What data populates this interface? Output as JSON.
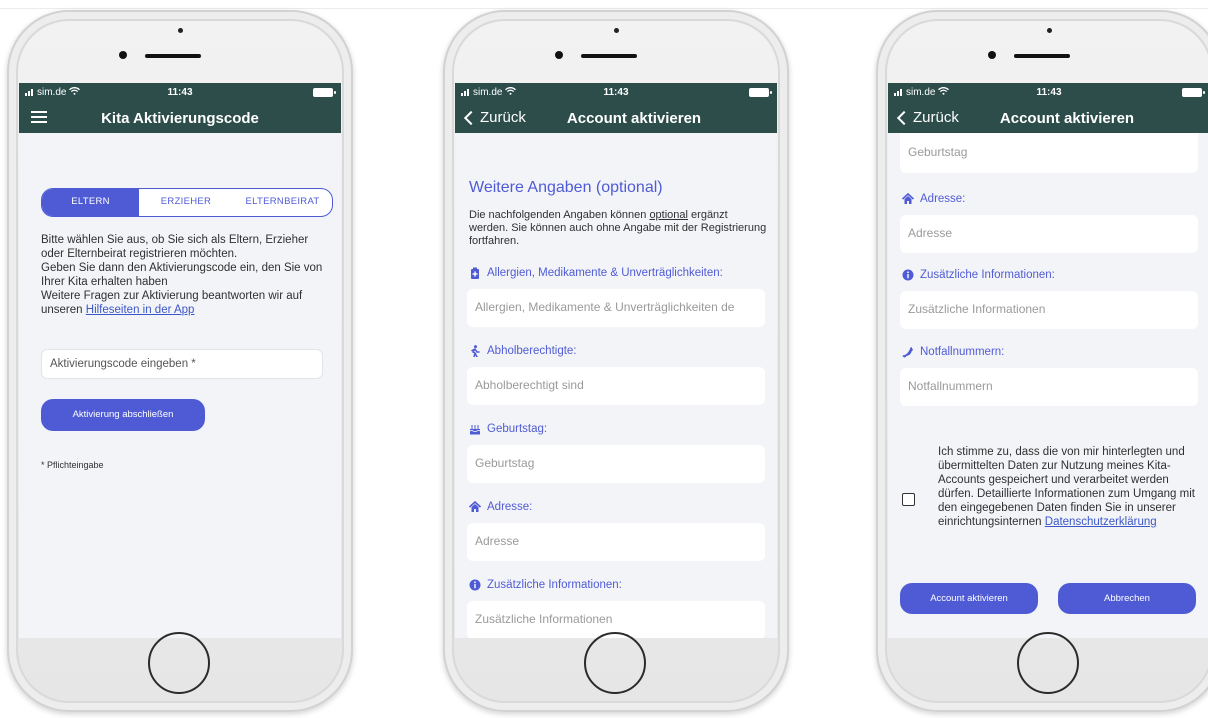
{
  "status": {
    "carrier": "sim.de",
    "time": "11:43"
  },
  "colors": {
    "header": "#2c4d4a",
    "accent": "#4f5bd5",
    "link": "#3b57c7",
    "background": "#f3f4f8"
  },
  "screen1": {
    "title": "Kita Aktivierungscode",
    "segments": [
      "ELTERN",
      "ERZIEHER",
      "ELTERNBEIRAT"
    ],
    "selected_segment": "ELTERN",
    "info_lines": [
      "Bitte wählen Sie aus, ob Sie sich als Eltern, Erzieher oder Elternbeirat registrieren möchten.",
      "Geben Sie dann den Aktivierungscode ein, den Sie von Ihrer Kita erhalten haben",
      "Weitere Fragen zur Aktivierung beantworten wir auf unseren "
    ],
    "help_link": "Hilfeseiten in der App",
    "code_placeholder": "Aktivierungscode eingeben *",
    "finish_button": "Aktivierung abschließen",
    "required_note": "* Pflichteingabe"
  },
  "screen2": {
    "back_label": "Zurück",
    "title": "Account aktivieren",
    "heading": "Weitere Angaben (optional)",
    "desc_pre": "Die nachfolgenden Angaben können ",
    "desc_optional": "optional",
    "desc_post": " ergänzt werden. Sie können auch ohne Angabe mit der Registrierung fortfahren.",
    "fields": [
      {
        "label": "Allergien, Medikamente & Unverträglichkeiten:",
        "placeholder": "Allergien, Medikamente & Unverträglichkeiten de",
        "icon": "medical-kit-icon"
      },
      {
        "label": "Abholberechtigte:",
        "placeholder": "Abholberechtigt sind",
        "icon": "walking-person-icon"
      },
      {
        "label": "Geburtstag:",
        "placeholder": "Geburtstag",
        "icon": "birthday-cake-icon"
      },
      {
        "label": "Adresse:",
        "placeholder": "Adresse",
        "icon": "home-icon"
      },
      {
        "label": "Zusätzliche Informationen:",
        "placeholder": "Zusätzliche Informationen",
        "icon": "info-icon"
      }
    ]
  },
  "screen3": {
    "back_label": "Zurück",
    "title": "Account aktivieren",
    "birthday_placeholder": "Geburtstag",
    "fields": [
      {
        "label": "Adresse:",
        "placeholder": "Adresse",
        "icon": "home-icon"
      },
      {
        "label": "Zusätzliche Informationen:",
        "placeholder": "Zusätzliche Informationen",
        "icon": "info-icon"
      },
      {
        "label": "Notfallnummern:",
        "placeholder": "Notfallnummern",
        "icon": "phone-icon"
      }
    ],
    "consent_text": "Ich stimme zu, dass die von mir hinterlegten und übermittelten Daten zur Nutzung meines Kita-Accounts gespeichert und verarbeitet werden dürfen. Detaillierte Informationen zum Umgang mit den eingegebenen Daten finden Sie in unserer einrichtungsinternen ",
    "consent_link": "Datenschutzerklärung",
    "activate_button": "Account aktivieren",
    "cancel_button": "Abbrechen"
  }
}
